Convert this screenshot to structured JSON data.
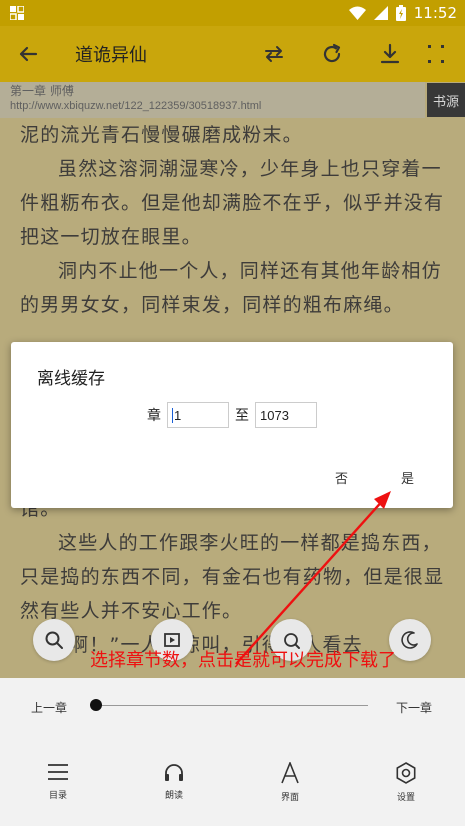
{
  "status_bar": {
    "time": "11:52"
  },
  "toolbar": {
    "title": "道诡异仙"
  },
  "chapter_info": {
    "title": "第一章 师傅",
    "url": "http://www.xbiquzw.net/122_122359/30518937.html",
    "source_button": "书源"
  },
  "content": {
    "paragraphs": [
      "泥的流光青石慢慢碾磨成粉末。",
      "虽然这溶洞潮湿寒冷，少年身上也只穿着一件粗粝布衣。但是他却满脸不在乎，似乎并没有把这一切放在眼里。",
      "洞内不止他一个人，同样还有其他年龄相仿的男男女女，同样束发，同样的粗布麻绳。",
      "馆。",
      "这些人的工作跟李火旺的一样都是捣东西，只是捣的东西不同，有金石也有药物，但是很显然有些人并不安心工作。",
      "“啊！”一人的惊叫，引得有人看去"
    ]
  },
  "dialog": {
    "title": "离线缓存",
    "from_label": "章",
    "from_value": "1",
    "to_label": "至",
    "to_value": "1073",
    "cancel_label": "否",
    "confirm_label": "是"
  },
  "progress": {
    "prev_label": "上一章",
    "next_label": "下一章",
    "position": 0
  },
  "bottom_nav": [
    {
      "label": "目录",
      "icon": "menu-icon"
    },
    {
      "label": "朗读",
      "icon": "headphones-icon"
    },
    {
      "label": "界面",
      "icon": "font-icon"
    },
    {
      "label": "设置",
      "icon": "settings-icon"
    }
  ],
  "annotation": {
    "text": "选择章节数，点击是就可以完成下载了"
  },
  "colors": {
    "toolbar": "#c9a60c",
    "annotation": "#ee1111",
    "page": "#d4c27f"
  }
}
